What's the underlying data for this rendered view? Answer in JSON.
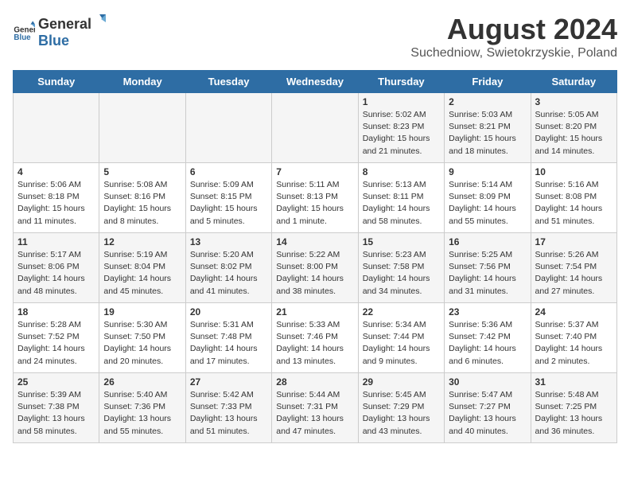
{
  "logo": {
    "general": "General",
    "blue": "Blue"
  },
  "title": "August 2024",
  "subtitle": "Suchedniow, Swietokrzyskie, Poland",
  "days_of_week": [
    "Sunday",
    "Monday",
    "Tuesday",
    "Wednesday",
    "Thursday",
    "Friday",
    "Saturday"
  ],
  "weeks": [
    [
      {
        "day": "",
        "detail": ""
      },
      {
        "day": "",
        "detail": ""
      },
      {
        "day": "",
        "detail": ""
      },
      {
        "day": "",
        "detail": ""
      },
      {
        "day": "1",
        "detail": "Sunrise: 5:02 AM\nSunset: 8:23 PM\nDaylight: 15 hours\nand 21 minutes."
      },
      {
        "day": "2",
        "detail": "Sunrise: 5:03 AM\nSunset: 8:21 PM\nDaylight: 15 hours\nand 18 minutes."
      },
      {
        "day": "3",
        "detail": "Sunrise: 5:05 AM\nSunset: 8:20 PM\nDaylight: 15 hours\nand 14 minutes."
      }
    ],
    [
      {
        "day": "4",
        "detail": "Sunrise: 5:06 AM\nSunset: 8:18 PM\nDaylight: 15 hours\nand 11 minutes."
      },
      {
        "day": "5",
        "detail": "Sunrise: 5:08 AM\nSunset: 8:16 PM\nDaylight: 15 hours\nand 8 minutes."
      },
      {
        "day": "6",
        "detail": "Sunrise: 5:09 AM\nSunset: 8:15 PM\nDaylight: 15 hours\nand 5 minutes."
      },
      {
        "day": "7",
        "detail": "Sunrise: 5:11 AM\nSunset: 8:13 PM\nDaylight: 15 hours\nand 1 minute."
      },
      {
        "day": "8",
        "detail": "Sunrise: 5:13 AM\nSunset: 8:11 PM\nDaylight: 14 hours\nand 58 minutes."
      },
      {
        "day": "9",
        "detail": "Sunrise: 5:14 AM\nSunset: 8:09 PM\nDaylight: 14 hours\nand 55 minutes."
      },
      {
        "day": "10",
        "detail": "Sunrise: 5:16 AM\nSunset: 8:08 PM\nDaylight: 14 hours\nand 51 minutes."
      }
    ],
    [
      {
        "day": "11",
        "detail": "Sunrise: 5:17 AM\nSunset: 8:06 PM\nDaylight: 14 hours\nand 48 minutes."
      },
      {
        "day": "12",
        "detail": "Sunrise: 5:19 AM\nSunset: 8:04 PM\nDaylight: 14 hours\nand 45 minutes."
      },
      {
        "day": "13",
        "detail": "Sunrise: 5:20 AM\nSunset: 8:02 PM\nDaylight: 14 hours\nand 41 minutes."
      },
      {
        "day": "14",
        "detail": "Sunrise: 5:22 AM\nSunset: 8:00 PM\nDaylight: 14 hours\nand 38 minutes."
      },
      {
        "day": "15",
        "detail": "Sunrise: 5:23 AM\nSunset: 7:58 PM\nDaylight: 14 hours\nand 34 minutes."
      },
      {
        "day": "16",
        "detail": "Sunrise: 5:25 AM\nSunset: 7:56 PM\nDaylight: 14 hours\nand 31 minutes."
      },
      {
        "day": "17",
        "detail": "Sunrise: 5:26 AM\nSunset: 7:54 PM\nDaylight: 14 hours\nand 27 minutes."
      }
    ],
    [
      {
        "day": "18",
        "detail": "Sunrise: 5:28 AM\nSunset: 7:52 PM\nDaylight: 14 hours\nand 24 minutes."
      },
      {
        "day": "19",
        "detail": "Sunrise: 5:30 AM\nSunset: 7:50 PM\nDaylight: 14 hours\nand 20 minutes."
      },
      {
        "day": "20",
        "detail": "Sunrise: 5:31 AM\nSunset: 7:48 PM\nDaylight: 14 hours\nand 17 minutes."
      },
      {
        "day": "21",
        "detail": "Sunrise: 5:33 AM\nSunset: 7:46 PM\nDaylight: 14 hours\nand 13 minutes."
      },
      {
        "day": "22",
        "detail": "Sunrise: 5:34 AM\nSunset: 7:44 PM\nDaylight: 14 hours\nand 9 minutes."
      },
      {
        "day": "23",
        "detail": "Sunrise: 5:36 AM\nSunset: 7:42 PM\nDaylight: 14 hours\nand 6 minutes."
      },
      {
        "day": "24",
        "detail": "Sunrise: 5:37 AM\nSunset: 7:40 PM\nDaylight: 14 hours\nand 2 minutes."
      }
    ],
    [
      {
        "day": "25",
        "detail": "Sunrise: 5:39 AM\nSunset: 7:38 PM\nDaylight: 13 hours\nand 58 minutes."
      },
      {
        "day": "26",
        "detail": "Sunrise: 5:40 AM\nSunset: 7:36 PM\nDaylight: 13 hours\nand 55 minutes."
      },
      {
        "day": "27",
        "detail": "Sunrise: 5:42 AM\nSunset: 7:33 PM\nDaylight: 13 hours\nand 51 minutes."
      },
      {
        "day": "28",
        "detail": "Sunrise: 5:44 AM\nSunset: 7:31 PM\nDaylight: 13 hours\nand 47 minutes."
      },
      {
        "day": "29",
        "detail": "Sunrise: 5:45 AM\nSunset: 7:29 PM\nDaylight: 13 hours\nand 43 minutes."
      },
      {
        "day": "30",
        "detail": "Sunrise: 5:47 AM\nSunset: 7:27 PM\nDaylight: 13 hours\nand 40 minutes."
      },
      {
        "day": "31",
        "detail": "Sunrise: 5:48 AM\nSunset: 7:25 PM\nDaylight: 13 hours\nand 36 minutes."
      }
    ]
  ]
}
